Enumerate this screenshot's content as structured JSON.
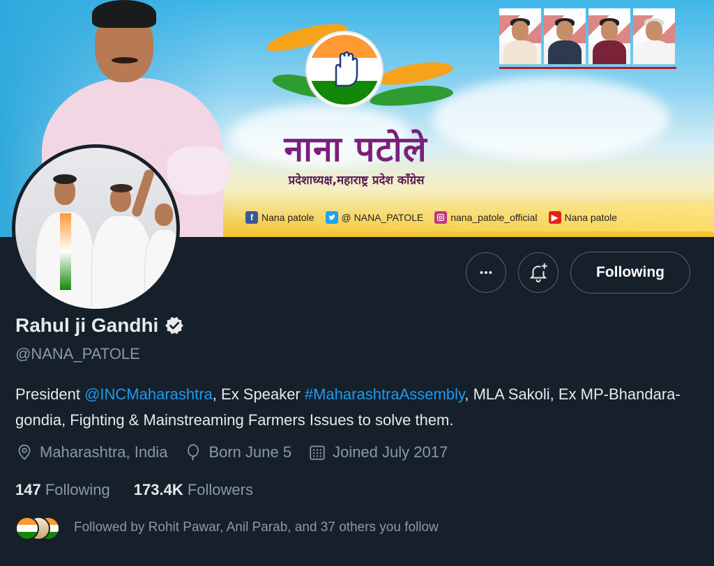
{
  "banner": {
    "title": "नाना पटोले",
    "subtitle": "प्रदेशाध्यक्ष,महाराष्ट्र प्रदेश काँग्रेस",
    "social": [
      {
        "icon": "facebook-icon",
        "label": "Nana patole",
        "color": "#3b5998"
      },
      {
        "icon": "twitter-icon",
        "label": "@ NANA_PATOLE",
        "color": "#1da1f2"
      },
      {
        "icon": "instagram-icon",
        "label": "nana_patole_official",
        "color": "#c13584"
      },
      {
        "icon": "youtube-icon",
        "label": "Nana patole",
        "color": "#e62117"
      }
    ]
  },
  "actions": {
    "more_icon": "more-icon",
    "notify_icon": "bell-plus-icon",
    "following_label": "Following"
  },
  "profile": {
    "name": "Rahul ji Gandhi",
    "verified_icon": "verified-badge-icon",
    "handle": "@NANA_PATOLE",
    "bio": {
      "t1": "President ",
      "link1": "@INCMaharashtra",
      "t2": ", Ex Speaker ",
      "link2": "#MaharashtraAssembly",
      "t3": ", MLA Sakoli, Ex MP-Bhandara-gondia, Fighting & Mainstreaming Farmers Issues to solve them."
    },
    "location": "Maharashtra, India",
    "born": "Born June 5",
    "joined": "Joined July 2017"
  },
  "stats": {
    "following_count": "147",
    "following_label": "Following",
    "followers_count": "173.4K",
    "followers_label": "Followers"
  },
  "followed_by": "Followed by Rohit Pawar, Anil Parab, and 37 others you follow",
  "colors": {
    "background": "#15202b",
    "text_primary": "#e7e9ea",
    "text_secondary": "#8b98a5",
    "link": "#1d9bf0",
    "border": "#536471"
  }
}
